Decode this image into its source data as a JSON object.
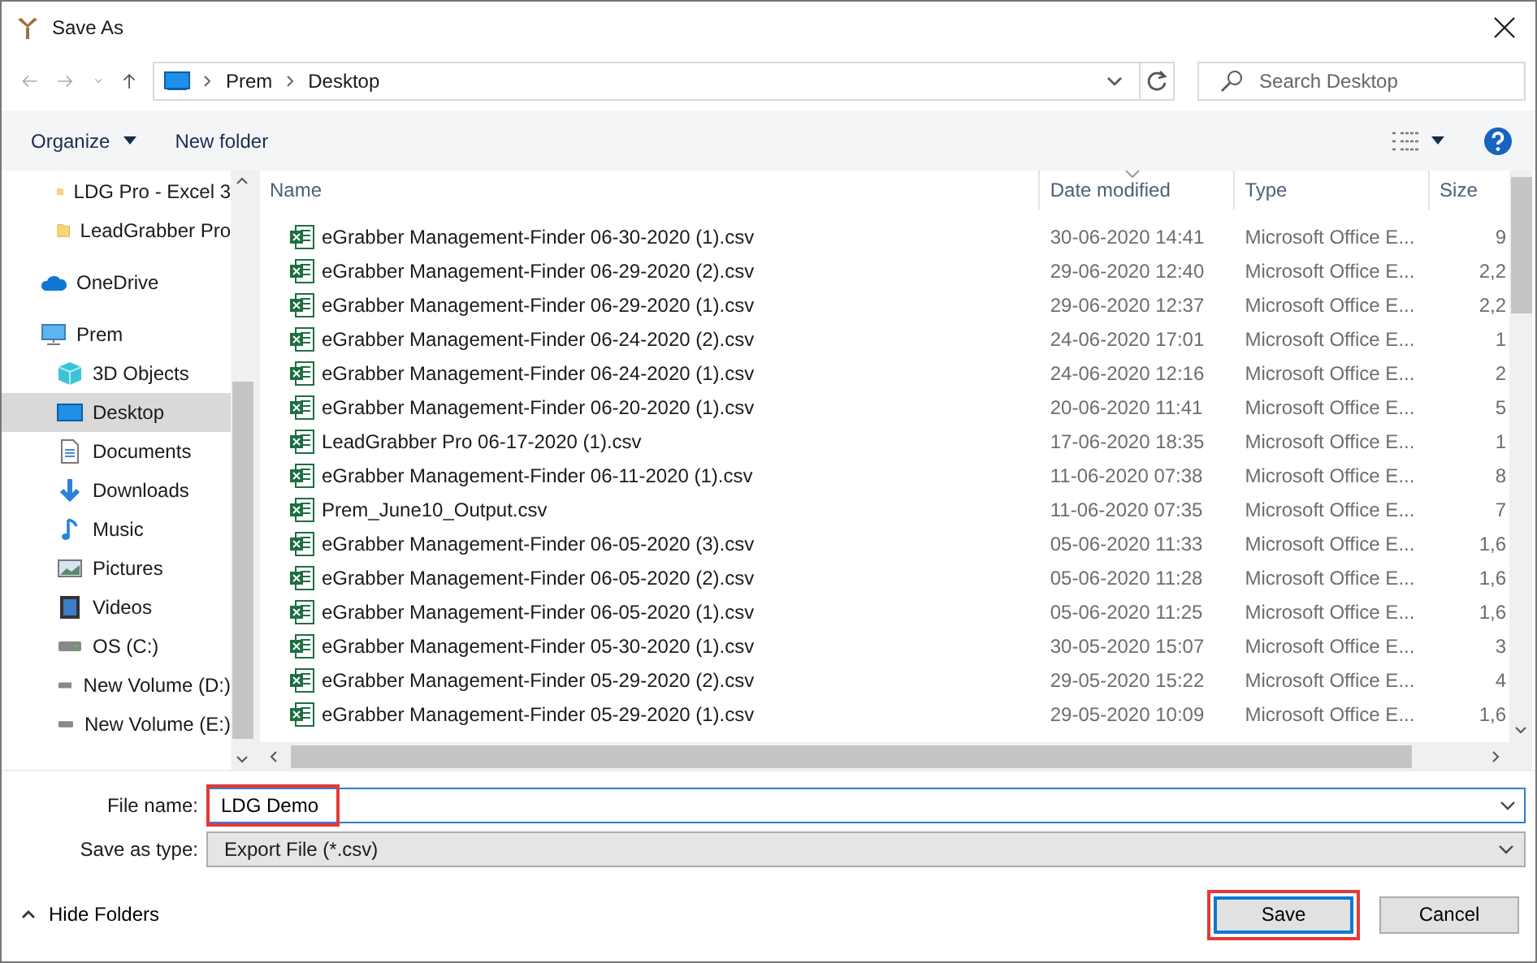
{
  "window": {
    "title": "Save As"
  },
  "address": {
    "path": [
      "Prem",
      "Desktop"
    ]
  },
  "search": {
    "placeholder": "Search Desktop"
  },
  "toolbar": {
    "organize": "Organize",
    "new_folder": "New folder"
  },
  "sidebar": {
    "items": [
      {
        "label": "LDG Pro - Excel 3",
        "kind": "folder",
        "selected": false,
        "nested": true
      },
      {
        "label": "LeadGrabber Pro",
        "kind": "folder",
        "selected": false,
        "nested": true
      },
      {
        "label": "OneDrive",
        "kind": "cloud",
        "selected": false,
        "nested": false
      },
      {
        "label": "Prem",
        "kind": "computer",
        "selected": false,
        "nested": false
      },
      {
        "label": "3D Objects",
        "kind": "cube",
        "selected": false,
        "nested": true
      },
      {
        "label": "Desktop",
        "kind": "desktop",
        "selected": true,
        "nested": true
      },
      {
        "label": "Documents",
        "kind": "document",
        "selected": false,
        "nested": true
      },
      {
        "label": "Downloads",
        "kind": "download",
        "selected": false,
        "nested": true
      },
      {
        "label": "Music",
        "kind": "music",
        "selected": false,
        "nested": true
      },
      {
        "label": "Pictures",
        "kind": "picture",
        "selected": false,
        "nested": true
      },
      {
        "label": "Videos",
        "kind": "video",
        "selected": false,
        "nested": true
      },
      {
        "label": "OS (C:)",
        "kind": "drive",
        "selected": false,
        "nested": true
      },
      {
        "label": "New Volume (D:)",
        "kind": "drive",
        "selected": false,
        "nested": true
      },
      {
        "label": "New Volume (E:)",
        "kind": "drive",
        "selected": false,
        "nested": true
      }
    ]
  },
  "table": {
    "columns": [
      "Name",
      "Date modified",
      "Type",
      "Size"
    ],
    "rows": [
      [
        "eGrabber Management-Finder 06-30-2020 (1).csv",
        "30-06-2020 14:41",
        "Microsoft Office E...",
        "9"
      ],
      [
        "eGrabber Management-Finder 06-29-2020 (2).csv",
        "29-06-2020 12:40",
        "Microsoft Office E...",
        "2,2"
      ],
      [
        "eGrabber Management-Finder 06-29-2020 (1).csv",
        "29-06-2020 12:37",
        "Microsoft Office E...",
        "2,2"
      ],
      [
        "eGrabber Management-Finder 06-24-2020 (2).csv",
        "24-06-2020 17:01",
        "Microsoft Office E...",
        "1"
      ],
      [
        "eGrabber Management-Finder 06-24-2020 (1).csv",
        "24-06-2020 12:16",
        "Microsoft Office E...",
        "2"
      ],
      [
        "eGrabber Management-Finder 06-20-2020 (1).csv",
        "20-06-2020 11:41",
        "Microsoft Office E...",
        "5"
      ],
      [
        "LeadGrabber Pro 06-17-2020 (1).csv",
        "17-06-2020 18:35",
        "Microsoft Office E...",
        "1"
      ],
      [
        "eGrabber Management-Finder 06-11-2020 (1).csv",
        "11-06-2020 07:38",
        "Microsoft Office E...",
        "8"
      ],
      [
        "Prem_June10_Output.csv",
        "11-06-2020 07:35",
        "Microsoft Office E...",
        "7"
      ],
      [
        "eGrabber Management-Finder 06-05-2020 (3).csv",
        "05-06-2020 11:33",
        "Microsoft Office E...",
        "1,6"
      ],
      [
        "eGrabber Management-Finder 06-05-2020 (2).csv",
        "05-06-2020 11:28",
        "Microsoft Office E...",
        "1,6"
      ],
      [
        "eGrabber Management-Finder 06-05-2020 (1).csv",
        "05-06-2020 11:25",
        "Microsoft Office E...",
        "1,6"
      ],
      [
        "eGrabber Management-Finder 05-30-2020 (1).csv",
        "30-05-2020 15:07",
        "Microsoft Office E...",
        "3"
      ],
      [
        "eGrabber Management-Finder 05-29-2020 (2).csv",
        "29-05-2020 15:22",
        "Microsoft Office E...",
        "4"
      ],
      [
        "eGrabber Management-Finder 05-29-2020 (1).csv",
        "29-05-2020 10:09",
        "Microsoft Office E...",
        "1,6"
      ]
    ]
  },
  "file_name": {
    "label": "File name:",
    "value": "LDG Demo",
    "highlighted": true
  },
  "save_type": {
    "label": "Save as type:",
    "value": "Export File (*.csv)"
  },
  "hide_folders": "Hide Folders",
  "buttons": [
    {
      "label": "Save",
      "default": true,
      "highlighted": true
    },
    {
      "label": "Cancel",
      "default": false,
      "highlighted": false
    }
  ]
}
